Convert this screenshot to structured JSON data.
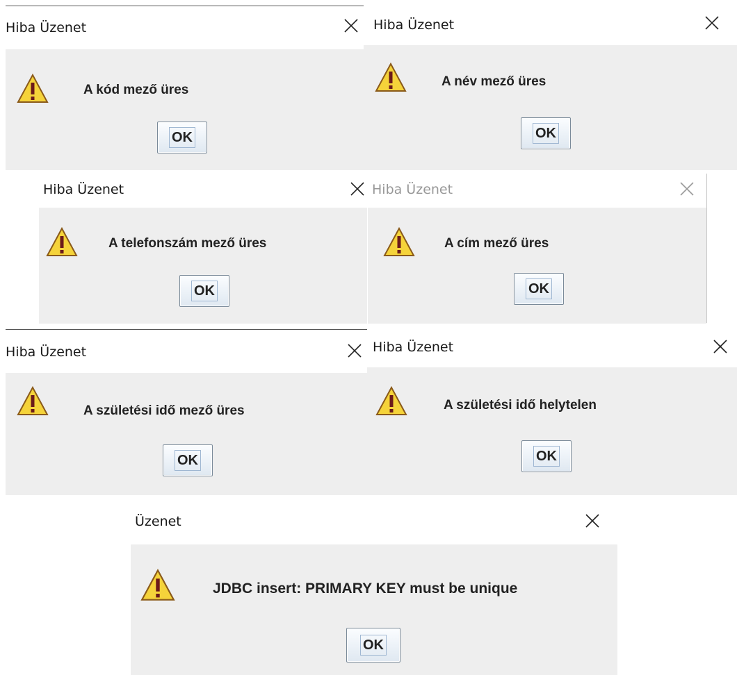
{
  "dialogs": [
    {
      "title": "Hiba Üzenet",
      "message": "A kód mező üres",
      "button": "OK"
    },
    {
      "title": "Hiba Üzenet",
      "message": "A név mező üres",
      "button": "OK"
    },
    {
      "title": "Hiba Üzenet",
      "message": "A telefonszám mező üres",
      "button": "OK"
    },
    {
      "title": "Hiba Üzenet",
      "message": "A cím mező üres",
      "button": "OK"
    },
    {
      "title": "Hiba Üzenet",
      "message": "A születési idő mező üres",
      "button": "OK"
    },
    {
      "title": "Hiba Üzenet",
      "message": "A születési idő helytelen",
      "button": "OK"
    },
    {
      "title": "Üzenet",
      "message": "JDBC insert: PRIMARY KEY must be unique",
      "button": "OK"
    }
  ],
  "icons": {
    "warning": "warning-icon",
    "close": "close-icon"
  },
  "colors": {
    "title_bar": "#ffffff",
    "content": "#eeeeee",
    "warning_fill": "#f5d33a",
    "warning_mark": "#6b1a1a"
  }
}
